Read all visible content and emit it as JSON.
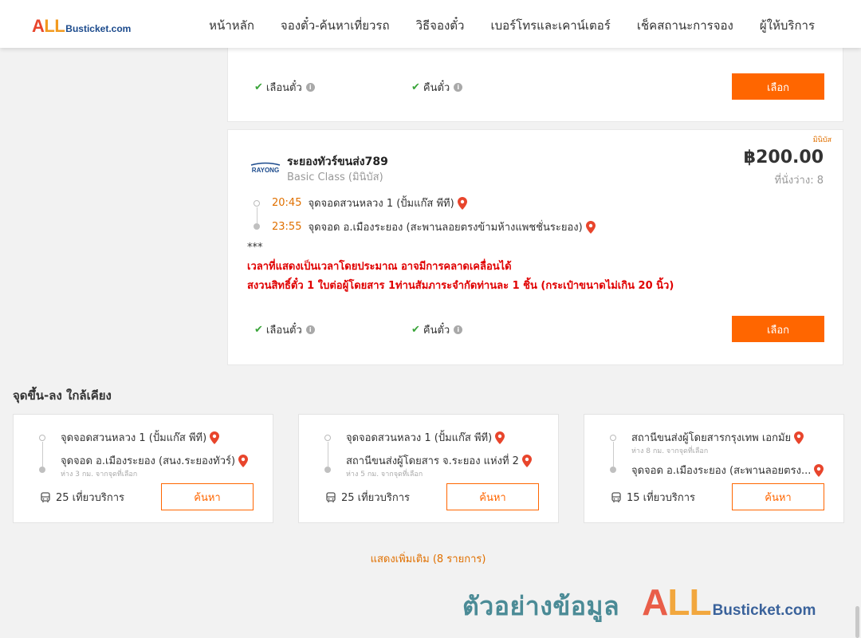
{
  "header": {
    "logo_all": "ALL",
    "logo_rest": "Busticket.com",
    "nav": [
      "หน้าหลัก",
      "จองตั๋ว-ค้นหาเที่ยวรถ",
      "วิธีจองตั๋ว",
      "เบอร์โทรและเคาน์เตอร์",
      "เช็คสถานะการจอง",
      "ผู้ให้บริการ"
    ]
  },
  "features": {
    "seat_selection": "เลือนตั๋ว",
    "refund": "คืนตั๋ว"
  },
  "select_label": "เลือก",
  "trip": {
    "bus_tag": "มินิบัส",
    "operator_logo_text": "RAYONG",
    "operator": "ระยองทัวร์ขนส่ง789",
    "class": "Basic Class (มินิบัส)",
    "price": "฿200.00",
    "seats": "ที่นั่งว่าง: 8",
    "departure_time": "20:45",
    "departure_stop": "จุดจอดสวนหลวง 1 (ปั้มแก๊ส พีที)",
    "arrival_time": "23:55",
    "arrival_stop": "จุดจอด อ.เมืองระยอง (สะพานลอยตรงข้ามห้างแพชชั่นระยอง)",
    "notice_stars": "***",
    "notice_line1": "เวลาที่แสดงเป็นเวลาโดยประมาณ อาจมีการคลาดเคลื่อนได้",
    "notice_line2": "สงวนสิทธิ์ตั๋ว 1 ใบต่อผู้โดยสาร 1ท่านสัมภาระจำกัดท่านละ 1 ชิ้น (กระเป๋าขนาดไม่เกิน 20 นิ้ว)"
  },
  "nearby": {
    "title": "จุดขึ้น-ลง ใกล้เคียง",
    "search_label": "ค้นหา",
    "cards": [
      {
        "from": "จุดจอดสวนหลวง 1 (ปั้มแก๊ส พีที)",
        "from_sub": "",
        "to": "จุดจอด อ.เมืองระยอง (สนง.ระยองทัวร์)",
        "to_sub": "ห่าง 3 กม. จากจุดที่เลือก",
        "trips": "25 เที่ยวบริการ"
      },
      {
        "from": "จุดจอดสวนหลวง 1 (ปั้มแก๊ส พีที)",
        "from_sub": "",
        "to": "สถานีขนส่งผู้โดยสาร จ.ระยอง แห่งที่ 2",
        "to_sub": "ห่าง 5 กม. จากจุดที่เลือก",
        "trips": "25 เที่ยวบริการ"
      },
      {
        "from": "สถานีขนส่งผู้โดยสารกรุงเทพ เอกมัย",
        "from_sub": "ห่าง 8 กม. จากจุดที่เลือก",
        "to": "จุดจอด อ.เมืองระยอง (สะพานลอยตรง...",
        "to_sub": "",
        "trips": "15 เที่ยวบริการ"
      }
    ],
    "show_more": "แสดงเพิ่มเติม (8 รายการ)"
  },
  "watermark": {
    "text": "ตัวอย่างข้อมูล",
    "logo_all": "ALL",
    "logo_rest": "Busticket.com"
  },
  "colors": {
    "accent_orange": "#ff6600",
    "time_orange": "#e07000",
    "notice_red": "#e00000",
    "check_green": "#3ba53b",
    "logo_red": "#e8452c",
    "logo_orange": "#f29a1f",
    "logo_blue": "#1b4a8c"
  }
}
